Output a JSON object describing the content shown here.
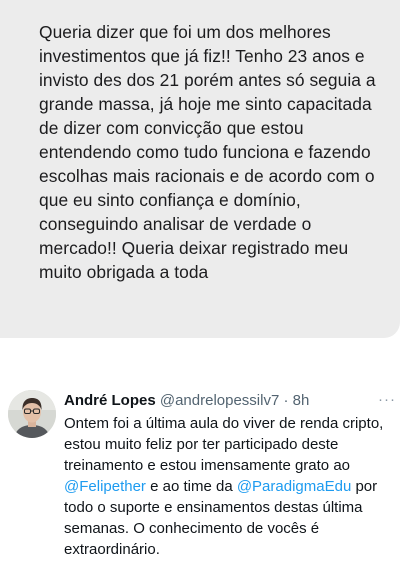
{
  "message": {
    "text": "Queria dizer que foi um dos melhores investimentos que já fiz!! Tenho 23 anos e invisto des dos 21 porém antes só seguia a grande massa, já hoje me sinto capacitada de dizer com convicção que estou entendendo como tudo funciona e fazendo escolhas mais racionais e de acordo com o que eu sinto confiança e domínio, conseguindo analisar de verdade o mercado!! Queria deixar registrado meu muito obrigada a toda"
  },
  "tweet": {
    "author_name": "André Lopes",
    "author_handle": "@andrelopessilv7",
    "separator": "·",
    "timestamp": "8h",
    "more_icon": "more-horizontal-icon",
    "more_glyph": "···",
    "body": {
      "part1": "Ontem foi a última aula do viver de renda cripto, estou muito feliz por ter participado deste treinamento e estou imensamente grato ao ",
      "mention1": "@Felipether",
      "part2": " e ao time da ",
      "mention2": "@ParadigmaEdu",
      "part3": " por todo o suporte e ensinamentos destas última semanas. O conhecimento de vocês é extraordinário."
    }
  },
  "colors": {
    "bubble_background": "#ececec",
    "mention": "#1d9bf0",
    "secondary_text": "#536471"
  }
}
